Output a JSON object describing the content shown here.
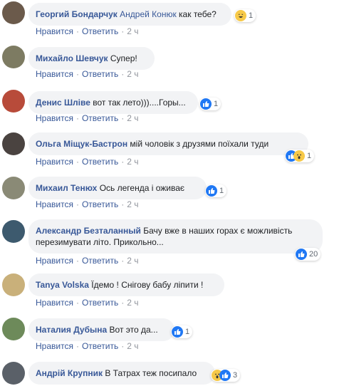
{
  "actions": {
    "like": "Нравится",
    "reply": "Ответить",
    "sep": "·"
  },
  "comments": [
    {
      "author": "Георгий Бондарчук",
      "tag": "Андрей Конюк",
      "text": "как тебе?",
      "reaction": "haha",
      "count": "1",
      "time": "2 ч",
      "avatar": "#6b5a4b"
    },
    {
      "author": "Михайло Шевчук",
      "tag": "",
      "text": "Супер!",
      "reaction": "",
      "count": "",
      "time": "2 ч",
      "avatar": "#7d7b62"
    },
    {
      "author": "Денис Шліве",
      "tag": "",
      "text": "вот так лето)))....Горы...",
      "reaction": "like",
      "count": "1",
      "time": "2 ч",
      "avatar": "#b84b3a"
    },
    {
      "author": "Ольга Міщук-Бастрон",
      "tag": "",
      "text": "мій чоловік з друзями поїхали туди",
      "reaction": "like-wow",
      "count": "1",
      "time": "2 ч",
      "avatar": "#4a4340"
    },
    {
      "author": "Михаил Тенюх",
      "tag": "",
      "text": "Ось легенда і оживає",
      "reaction": "like",
      "count": "1",
      "time": "2 ч",
      "avatar": "#8a8a76"
    },
    {
      "author": "Александр Безталанный",
      "tag": "",
      "text": "Бачу вже в наших горах є можливість перезимувати літо. Прикольно...",
      "reaction": "like",
      "count": "20",
      "time": "2 ч",
      "avatar": "#3d5a6e"
    },
    {
      "author": "Tanya Volska",
      "tag": "",
      "text": "Їдемо ! Снігову бабу ліпити !",
      "reaction": "",
      "count": "",
      "time": "2 ч",
      "avatar": "#c9b07a"
    },
    {
      "author": "Наталия Дубына",
      "tag": "",
      "text": "Вот это да...",
      "reaction": "like",
      "count": "1",
      "time": "2 ч",
      "avatar": "#6d8a5a"
    },
    {
      "author": "Андрій Крупник",
      "tag": "",
      "text": "В Татрах теж посипало",
      "reaction": "wow-like",
      "count": "3",
      "time": "",
      "avatar": "#5a6068"
    }
  ]
}
